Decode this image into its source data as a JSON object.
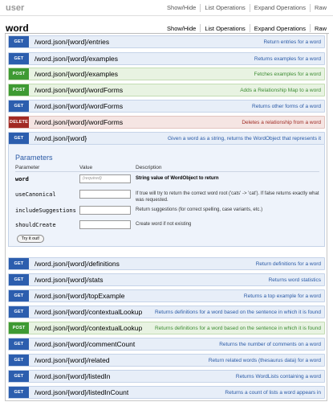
{
  "resources": {
    "user": {
      "name": "user",
      "links": [
        "Show/Hide",
        "List Operations",
        "Expand Operations",
        "Raw"
      ]
    },
    "word": {
      "name": "word",
      "links": [
        "Show/Hide",
        "List Operations",
        "Expand Operations",
        "Raw"
      ]
    }
  },
  "colors": {
    "get": "#2c5eae",
    "post": "#3e9a33",
    "delete": "#a22a24"
  },
  "operations_top": [
    {
      "method": "GET",
      "path": "/word.json/{word}/entries",
      "summary": "Return entries for a word"
    },
    {
      "method": "GET",
      "path": "/word.json/{word}/examples",
      "summary": "Returns examples for a word"
    },
    {
      "method": "POST",
      "path": "/word.json/{word}/examples",
      "summary": "Fetches examples for a word"
    },
    {
      "method": "POST",
      "path": "/word.json/{word}/wordForms",
      "summary": "Adds a Relationship Map to a word"
    },
    {
      "method": "GET",
      "path": "/word.json/{word}/wordForms",
      "summary": "Returns other forms of a word"
    },
    {
      "method": "DELETE",
      "path": "/word.json/{word}/wordForms",
      "summary": "Deletes a relationship from a word"
    },
    {
      "method": "GET",
      "path": "/word.json/{word}",
      "summary": "Given a word as a string, returns the WordObject that represents it"
    }
  ],
  "parameters": {
    "title": "Parameters",
    "headers": [
      "Parameter",
      "Value",
      "Description"
    ],
    "rows": [
      {
        "name": "word",
        "placeholder": "(required)",
        "description": "String value of WordObject to return",
        "required": true
      },
      {
        "name": "useCanonical",
        "placeholder": "",
        "description": "If true will try to return the correct word root ('cats' -> 'cat'). If false returns exactly what was requested.",
        "required": false
      },
      {
        "name": "includeSuggestions",
        "placeholder": "",
        "description": "Return suggestions (for correct spelling, case variants, etc.)",
        "required": false
      },
      {
        "name": "shouldCreate",
        "placeholder": "",
        "description": "Create word if not existing",
        "required": false
      }
    ],
    "try_label": "Try it out!"
  },
  "operations_bottom": [
    {
      "method": "GET",
      "path": "/word.json/{word}/definitions",
      "summary": "Return definitions for a word"
    },
    {
      "method": "GET",
      "path": "/word.json/{word}/stats",
      "summary": "Returns word statistics"
    },
    {
      "method": "GET",
      "path": "/word.json/{word}/topExample",
      "summary": "Returns a top example for a word"
    },
    {
      "method": "GET",
      "path": "/word.json/{word}/contextualLookup",
      "summary": "Returns definitions for a word based on the sentence in which it is found"
    },
    {
      "method": "POST",
      "path": "/word.json/{word}/contextualLookup",
      "summary": "Returns definitions for a word based on the sentence in which it is found"
    },
    {
      "method": "GET",
      "path": "/word.json/{word}/commentCount",
      "summary": "Returns the number of comments on a word"
    },
    {
      "method": "GET",
      "path": "/word.json/{word}/related",
      "summary": "Return related words (thesaurus data) for a word"
    },
    {
      "method": "GET",
      "path": "/word.json/{word}/listedIn",
      "summary": "Returns WordLists containing a word"
    },
    {
      "method": "GET",
      "path": "/word.json/{word}/listedInCount",
      "summary": "Returns a count of lists a word appears in"
    }
  ]
}
